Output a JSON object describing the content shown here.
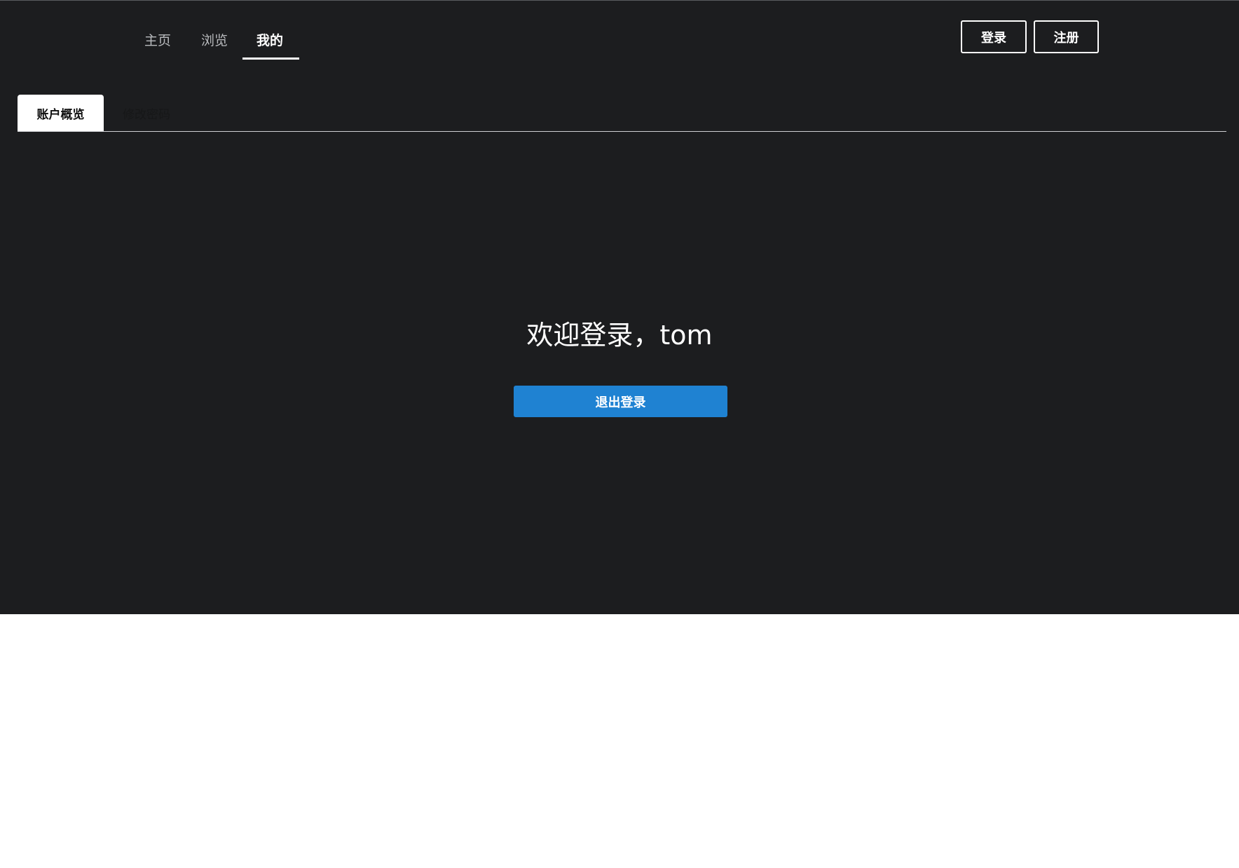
{
  "nav": {
    "links": [
      {
        "label": "主页",
        "active": false
      },
      {
        "label": "浏览",
        "active": false
      },
      {
        "label": "我的",
        "active": true
      }
    ],
    "login_label": "登录",
    "register_label": "注册"
  },
  "tabs": [
    {
      "label": "账户概览",
      "active": true
    },
    {
      "label": "修改密码",
      "active": false
    }
  ],
  "main": {
    "welcome_text": "欢迎登录，tom",
    "logout_label": "退出登录"
  },
  "colors": {
    "background": "#1c1d1f",
    "accent": "#1f82d2",
    "text": "#ffffff"
  }
}
